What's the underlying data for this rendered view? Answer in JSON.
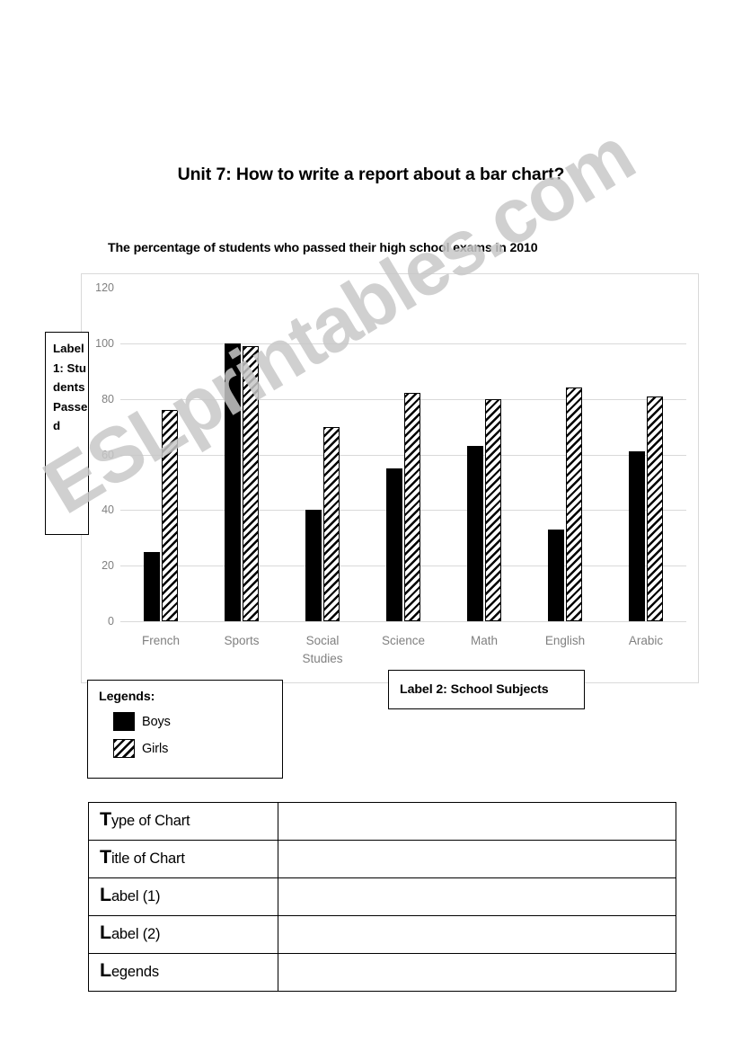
{
  "worksheet": {
    "title": "Unit 7: How to write a report about a bar chart?",
    "watermark": "ESLprintables.com"
  },
  "chart_caption": "The percentage of students who passed their high school exams in 2010",
  "annotations": {
    "label1": "Label 1: Students Passed",
    "label2": "Label 2: School Subjects",
    "legends_title": "Legends:",
    "legend_boys": "Boys",
    "legend_girls": "Girls",
    "legend_boys_icon": "black-square-swatch",
    "legend_girls_icon": "hatched-square-swatch"
  },
  "answer_table": {
    "rows": [
      {
        "first": "T",
        "rest": "ype of Chart",
        "answer": ""
      },
      {
        "first": "T",
        "rest": "itle of Chart",
        "answer": ""
      },
      {
        "first": "L",
        "rest": "abel (1)",
        "answer": ""
      },
      {
        "first": "L",
        "rest": "abel (2)",
        "answer": ""
      },
      {
        "first": "L",
        "rest": "egends",
        "answer": ""
      }
    ]
  },
  "chart_data": {
    "type": "bar",
    "title": "The percentage of students who passed their high school exams in 2010",
    "xlabel": "School Subjects",
    "ylabel": "Students Passed",
    "categories": [
      "French",
      "Sports",
      "Social Studies",
      "Science",
      "Math",
      "English",
      "Arabic"
    ],
    "series": [
      {
        "name": "Boys",
        "values": [
          25,
          100,
          40,
          55,
          63,
          33,
          61
        ],
        "fill": "solid-black",
        "color": "#000000"
      },
      {
        "name": "Girls",
        "values": [
          76,
          99,
          70,
          82,
          80,
          84,
          81
        ],
        "fill": "diagonal-hatch",
        "color": "#000000"
      }
    ],
    "ylim": [
      0,
      120
    ],
    "yticks": [
      0,
      20,
      40,
      60,
      80,
      100,
      120
    ],
    "ytick_labels": [
      "0",
      "20",
      "40",
      "60",
      "80",
      "100",
      "120"
    ],
    "grid": true,
    "legend_position": "external-box-below-left",
    "axis_label_color": "#808080",
    "gridline_color": "#d9d9d9",
    "frame_color": "#d9d9d9"
  }
}
